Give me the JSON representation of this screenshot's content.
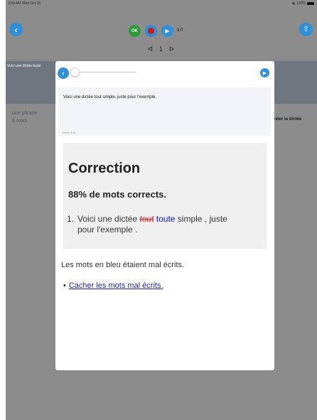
{
  "status_bar": {
    "time_date": "3:09 AM  Wed Oct 16",
    "battery": "100%",
    "wifi_icon": "wifi-icon",
    "battery_icon": "battery-icon"
  },
  "toolbar": {
    "back_icon": "chevron-left-icon",
    "share_icon": "share-icon",
    "ok_label": "OK",
    "record_icon": "record-icon",
    "play_icon": "play-icon",
    "speed": "9.0",
    "prev_icon": "ᐊ",
    "page": "1",
    "next_icon": "ᐅ",
    "accent_color": "#2f8fd8",
    "ok_color": "#2e9b3a",
    "record_color": "#d21414"
  },
  "background_list": {
    "row_title": "Voici une dictée toute",
    "meta_line1": "une phrase",
    "meta_line2": "8 mots",
    "test_label": "ester la dictée"
  },
  "modal": {
    "back_icon": "chevron-left-icon",
    "play_icon": "play-icon",
    "slider_value": 0,
    "dictation_text": "Voici une dictée tout simple, juste pour l'exemple.",
    "text_footer": "Dictée finie.",
    "correction": {
      "title": "Correction",
      "score": "88% de mots corrects.",
      "item_number": "1.",
      "sentence_before": "Voici une dictée ",
      "wrong_word": "tout",
      "correct_word": "toute",
      "sentence_after": " simple , juste",
      "sentence_line2": "pour l'exemple ."
    },
    "note": "Les mots en bleu étaient mal écrits.",
    "hide_link": "Cacher les mots mal écrits.",
    "wrong_color": "#e22020",
    "correct_color": "#1212c8"
  }
}
